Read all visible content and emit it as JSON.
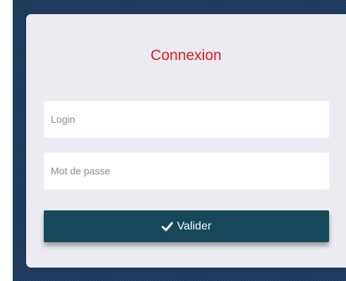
{
  "login_form": {
    "title": "Connexion",
    "login_placeholder": "Login",
    "password_placeholder": "Mot de passe",
    "submit_label": "Valider",
    "submit_icon": "check-icon"
  },
  "colors": {
    "title": "#dd1b1b",
    "button": "#16485a",
    "card": "#ebebf1",
    "backdrop": "#1d3a5e"
  }
}
